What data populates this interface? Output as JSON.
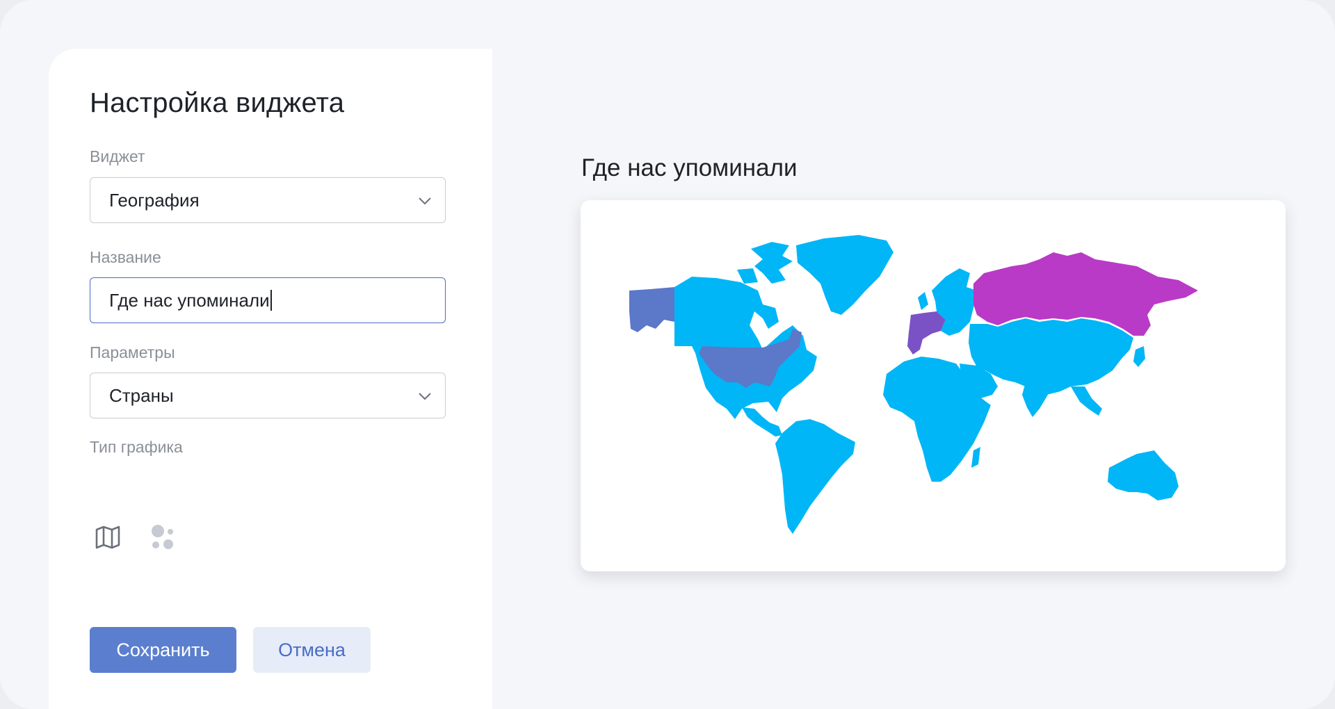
{
  "panel": {
    "title": "Настройка виджета",
    "widget_label": "Виджет",
    "widget_value": "География",
    "name_label": "Название",
    "name_value": "Где нас упоминали",
    "params_label": "Параметры",
    "params_value": "Страны",
    "chart_type_label": "Тип графика",
    "chart_types": [
      {
        "icon": "map-icon",
        "selected": true
      },
      {
        "icon": "bubbles-icon",
        "selected": false
      }
    ],
    "save_label": "Сохранить",
    "cancel_label": "Отмена"
  },
  "preview": {
    "title": "Где нас упоминали"
  },
  "map": {
    "base_color": "#00b6f6",
    "highlight_colors": {
      "usa": "#5b78c9",
      "alaska": "#5b78c9",
      "western_europe": "#7b52c6",
      "russia": "#b93ac6"
    }
  },
  "colors": {
    "accent": "#5b7fce",
    "cancel_bg": "#e6ecf8"
  }
}
